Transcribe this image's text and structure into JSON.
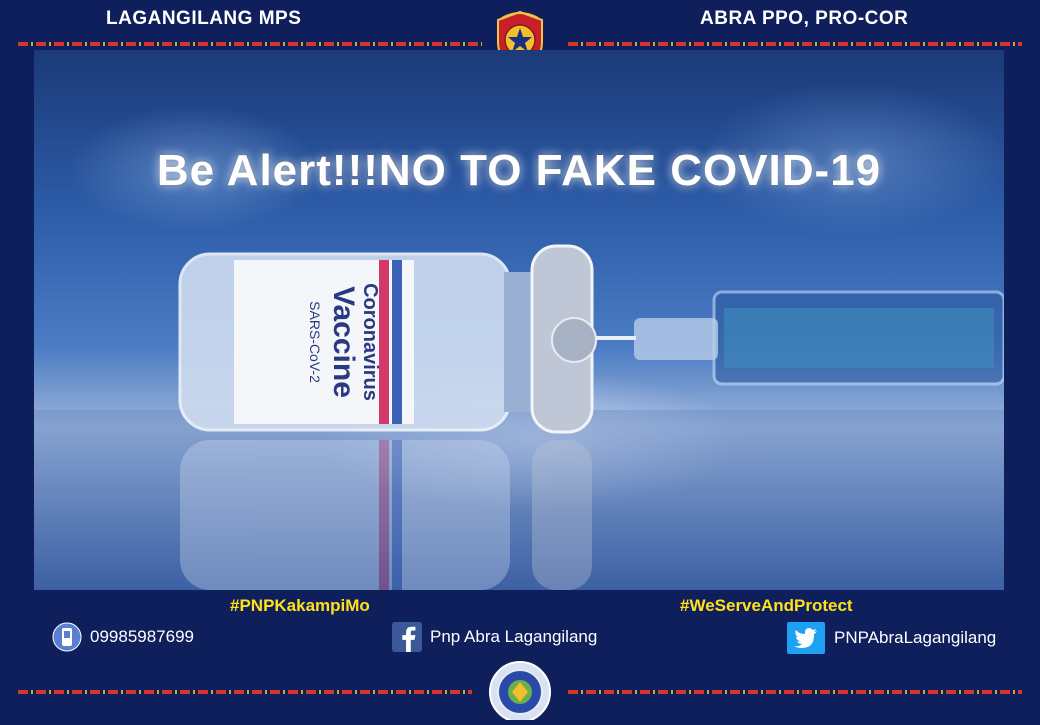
{
  "header": {
    "left": "LAGANGILANG MPS",
    "right": "ABRA PPO, PRO-COR"
  },
  "banner": {
    "headline": "Be Alert!!!NO TO FAKE COVID-19"
  },
  "vial_label": {
    "line1": "Coronavirus",
    "line2": "Vaccine",
    "line3": "SARS-CoV-2"
  },
  "hashtags": {
    "left": "#PNPKakampiMo",
    "right": "#WeServeAndProtect"
  },
  "contacts": {
    "phone": {
      "icon": "phone-icon",
      "text": "09985987699"
    },
    "facebook": {
      "icon": "facebook-icon",
      "text": "Pnp Abra Lagangilang"
    },
    "twitter": {
      "icon": "twitter-icon",
      "text": "PNPAbraLagangilang"
    }
  },
  "colors": {
    "background": "#0f1f5c",
    "hashtag": "#ffe01a",
    "facebook": "#3b5998",
    "twitter": "#1da1f2"
  }
}
